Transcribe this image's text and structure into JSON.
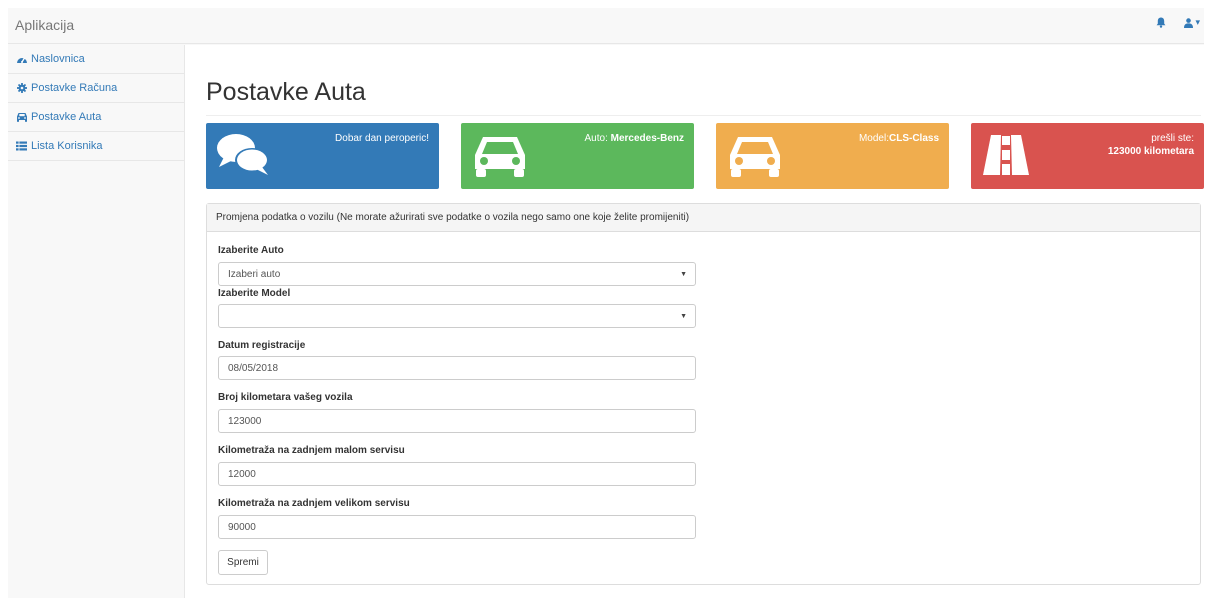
{
  "app": {
    "brand": "Aplikacija"
  },
  "navbar": {
    "notification_icon": "bell-icon",
    "user_icon": "user-icon",
    "caret": "▾"
  },
  "sidebar": {
    "items": [
      {
        "label": "Naslovnica",
        "icon": "dashboard-icon"
      },
      {
        "label": "Postavke Računa",
        "icon": "gear-icon"
      },
      {
        "label": "Postavke Auta",
        "icon": "car-icon"
      },
      {
        "label": "Lista Korisnika",
        "icon": "list-icon"
      }
    ]
  },
  "page": {
    "title": "Postavke Auta"
  },
  "panels": {
    "greeting": {
      "text": "Dobar dan peroperic!",
      "icon": "comments-icon",
      "color": "#337ab7"
    },
    "auto": {
      "prefix": "Auto: ",
      "value": "Mercedes-Benz",
      "icon": "car-icon",
      "color": "#5cb85c"
    },
    "model": {
      "prefix": "Model:",
      "value": "CLS-Class",
      "icon": "car-icon",
      "color": "#f0ad4e"
    },
    "km": {
      "prefix": "prešli ste:",
      "value": "123000 kilometara",
      "icon": "road-icon",
      "color": "#d9534f"
    }
  },
  "form": {
    "heading": "Promjena podatka o vozilu (Ne morate ažurirati sve podatke o vozila nego samo one koje želite promijeniti)",
    "auto_label": "Izaberite Auto",
    "auto_value": "Izaberi auto",
    "model_label": "Izaberite Model",
    "model_value": "",
    "date_label": "Datum registracije",
    "date_value": "08/05/2018",
    "km_label": "Broj kilometara vašeg vozila",
    "km_value": "123000",
    "small_service_label": "Kilometraža na zadnjem malom servisu",
    "small_service_value": "12000",
    "big_service_label": "Kilometraža na zadnjem velikom servisu",
    "big_service_value": "90000",
    "save_label": "Spremi"
  }
}
